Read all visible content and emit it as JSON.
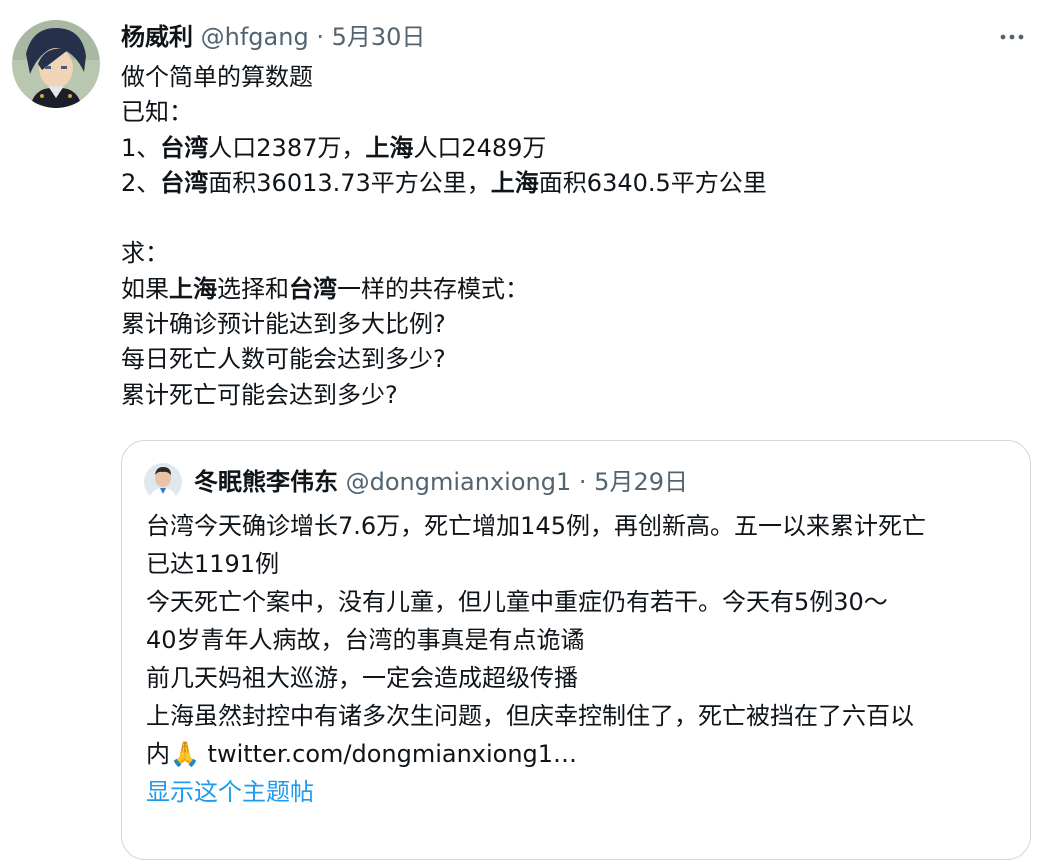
{
  "tweet": {
    "author_name": "杨威利",
    "author_handle": "@hfgang",
    "separator": "·",
    "date": "5月30日",
    "more_icon": "more-dots-icon",
    "lines": [
      [
        {
          "t": "做个简单的算数题",
          "b": false
        }
      ],
      [
        {
          "t": "已知：",
          "b": false
        }
      ],
      [
        {
          "t": "1、",
          "b": false
        },
        {
          "t": "台湾",
          "b": true
        },
        {
          "t": "人口2387万，",
          "b": false
        },
        {
          "t": "上海",
          "b": true
        },
        {
          "t": "人口2489万",
          "b": false
        }
      ],
      [
        {
          "t": "2、",
          "b": false
        },
        {
          "t": "台湾",
          "b": true
        },
        {
          "t": "面积36013.73平方公里，",
          "b": false
        },
        {
          "t": "上海",
          "b": true
        },
        {
          "t": "面积6340.5平方公里",
          "b": false
        }
      ],
      [],
      [
        {
          "t": "求：",
          "b": false
        }
      ],
      [
        {
          "t": "如果",
          "b": false
        },
        {
          "t": "上海",
          "b": true
        },
        {
          "t": "选择和",
          "b": false
        },
        {
          "t": "台湾",
          "b": true
        },
        {
          "t": "一样的共存模式：",
          "b": false
        }
      ],
      [
        {
          "t": "累计确诊预计能达到多大比例?",
          "b": false
        }
      ],
      [
        {
          "t": "每日死亡人数可能会达到多少?",
          "b": false
        }
      ],
      [
        {
          "t": "累计死亡可能会达到多少?",
          "b": false
        }
      ]
    ]
  },
  "quote": {
    "author_name": "冬眠熊李伟东",
    "author_handle": "@dongmianxiong1",
    "separator": "·",
    "date": "5月29日",
    "lines": [
      "台湾今天确诊增长7.6万，死亡增加145例，再创新高。五一以来累计死亡",
      "已达1191例",
      "今天死亡个案中，没有儿童，但儿童中重症仍有若干。今天有5例30～",
      "40岁青年人病故，台湾的事真是有点诡谲",
      "前几天妈祖大巡游，一定会造成超级传播",
      "上海虽然封控中有诸多次生问题，但庆幸控制住了，死亡被挡在了六百以"
    ],
    "last_line_text": "内",
    "emoji": "🙏",
    "link_text": "twitter.com/dongmianxiong1…",
    "show_thread": "显示这个主题帖"
  }
}
